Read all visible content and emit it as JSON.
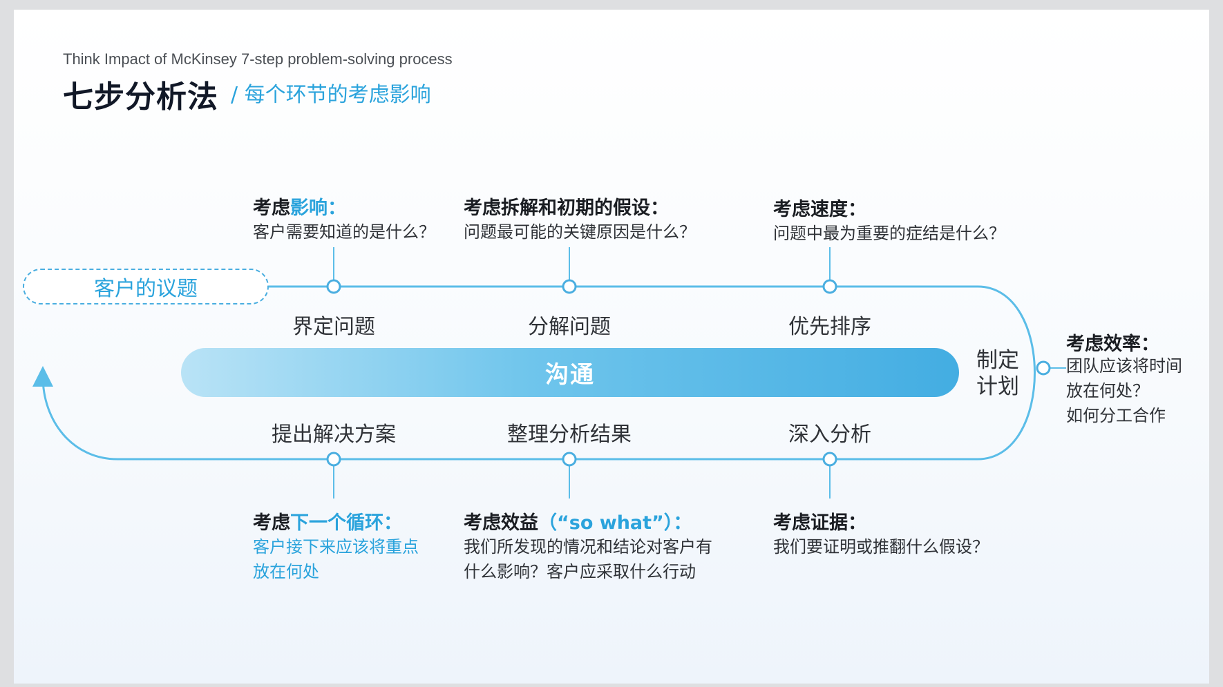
{
  "header": {
    "subtitle_en": "Think Impact of  McKinsey 7-step problem-solving process",
    "title": "七步分析法",
    "title_sub": "/ 每个环节的考虑影响"
  },
  "topic_box": "客户的议题",
  "center_bar": "沟通",
  "plan_label_line1": "制定",
  "plan_label_line2": "计划",
  "steps_top": [
    "界定问题",
    "分解问题",
    "优先排序"
  ],
  "steps_bottom": [
    "提出解决方案",
    "整理分析结果",
    "深入分析"
  ],
  "notes_top": [
    {
      "head_plain": "考虑",
      "head_hl": "影响",
      "head_tail": "：",
      "body": [
        "客户需要知道的是什么？"
      ]
    },
    {
      "head_plain": "考虑拆解和初期的假设：",
      "head_hl": "",
      "head_tail": "",
      "body": [
        "问题最可能的关键原因是什么？"
      ]
    },
    {
      "head_plain": "考虑速度：",
      "head_hl": "",
      "head_tail": "",
      "body": [
        "问题中最为重要的症结是什么？"
      ]
    }
  ],
  "notes_bottom": [
    {
      "head_plain": "考虑",
      "head_hl": "下一个循环",
      "head_tail": "：",
      "body": [
        "客户接下来应该将重点",
        "放在何处"
      ]
    },
    {
      "head_plain": "考虑效益",
      "head_hl": "（“so what”）",
      "head_tail": "：",
      "body": [
        "我们所发现的情况和结论对客户有",
        "什么影响？客户应采取什么行动"
      ]
    },
    {
      "head_plain": "考虑证据：",
      "head_hl": "",
      "head_tail": "",
      "body": [
        "我们要证明或推翻什么假设？"
      ]
    }
  ],
  "note_right": {
    "head": "考虑效率：",
    "body": [
      "团队应该将时间",
      "放在何处？",
      "如何分工合作"
    ]
  },
  "colors": {
    "accent": "#2aa3dc",
    "line": "#5bbde8",
    "text_dark": "#1a1d22"
  }
}
